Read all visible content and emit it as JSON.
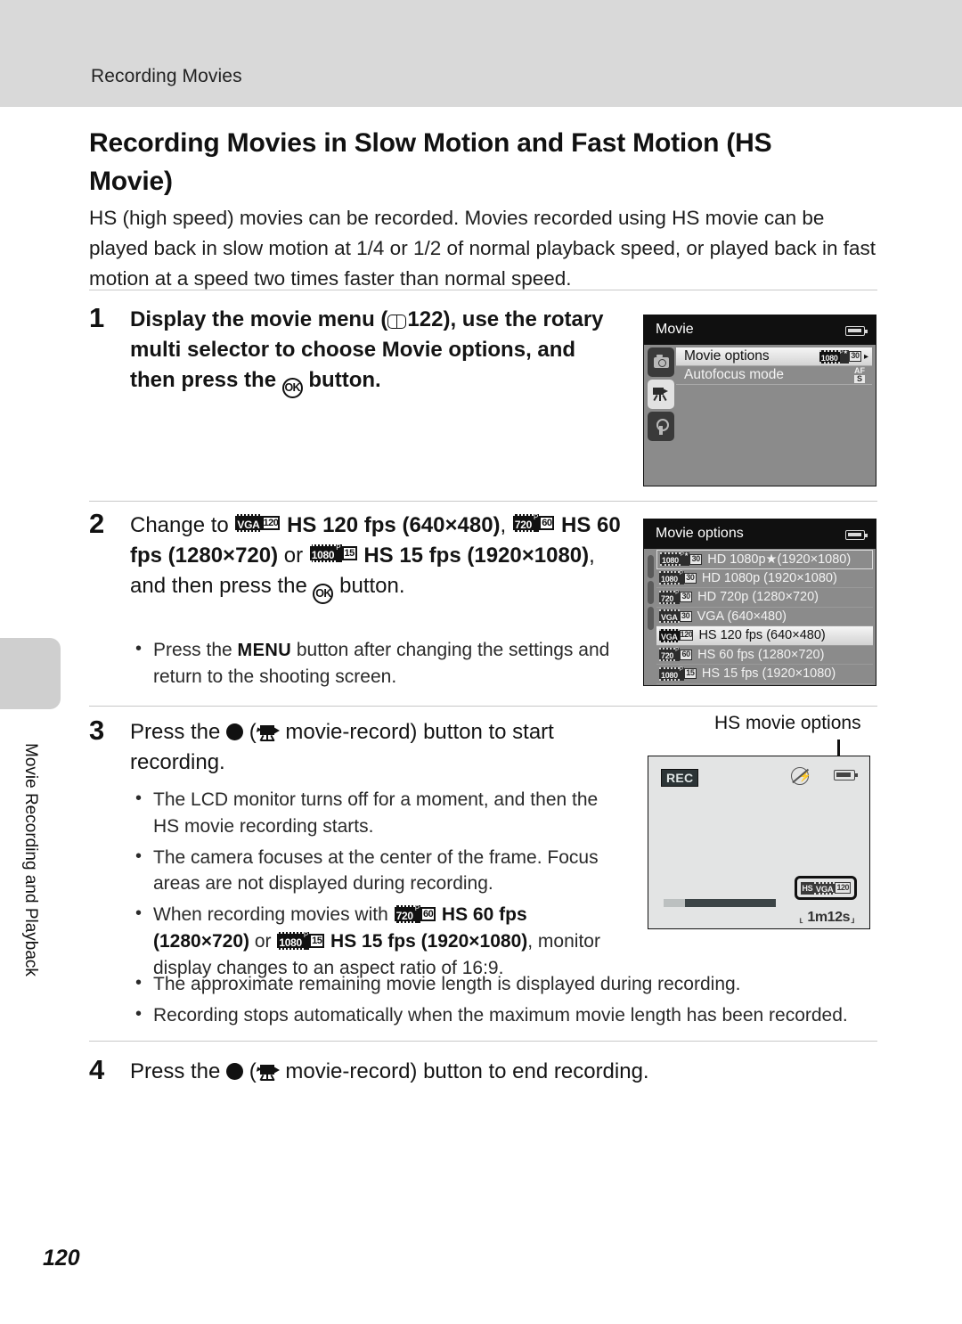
{
  "header": {
    "running_head": "Recording Movies"
  },
  "thumb_tab": {
    "label": "Movie Recording and Playback"
  },
  "title": "Recording Movies in Slow Motion and Fast Motion (HS Movie)",
  "intro": "HS (high speed) movies can be recorded. Movies recorded using HS movie can be played back in slow motion at 1/4 or 1/2 of normal playback speed, or played back in fast motion at a speed two times faster than normal speed.",
  "steps": [
    {
      "number": "1",
      "text_part1": "Display the movie menu (",
      "page_ref": "122",
      "text_part2": "), use the rotary multi selector to choose ",
      "bold1": "Movie options",
      "text_part3": ", and then press the ",
      "ok_label": "OK",
      "text_part4": " button."
    },
    {
      "number": "2",
      "text_part1": "Change to ",
      "bold1": "HS 120 fps (640×480)",
      "text_part2": ", ",
      "bold2": "HS 60 fps (1280×720)",
      "text_part3": " or ",
      "bold3": "HS 15 fps (1920×1080)",
      "text_part4": ", and then press the ",
      "ok_label": "OK",
      "text_part5": " button.",
      "bullets": [
        {
          "part1": "Press the ",
          "menu_label": "MENU",
          "part2": " button after changing the settings and return to the shooting screen."
        }
      ]
    },
    {
      "number": "3",
      "text_part1": "Press the ",
      "text_part2": " (",
      "text_part3": " movie-record) button to start recording.",
      "bullets": [
        {
          "text": "The LCD monitor turns off for a moment, and then the HS movie recording starts."
        },
        {
          "text": "The camera focuses at the center of the frame. Focus areas are not displayed during recording."
        },
        {
          "part1": "When recording movies with ",
          "bold1": "HS 60 fps (1280×720)",
          "part2": " or ",
          "bold2": "HS 15 fps (1920×1080)",
          "part3": ", monitor display changes to an aspect ratio of 16:9."
        },
        {
          "text": "The approximate remaining movie length is displayed during recording."
        },
        {
          "text": "Recording stops automatically when the maximum movie length has been recorded."
        }
      ]
    },
    {
      "number": "4",
      "text_part1": "Press the ",
      "text_part2": " (",
      "text_part3": " movie-record) button to end recording."
    }
  ],
  "figure_movie_menu": {
    "title": "Movie",
    "tabs": [
      {
        "name": "shooting-tab",
        "active": false
      },
      {
        "name": "movie-tab",
        "active": true
      },
      {
        "name": "setup-tab",
        "active": false
      }
    ],
    "rows": [
      {
        "label": "Movie options",
        "selected": true,
        "badge_res": "1080",
        "badge_sup": "P★",
        "badge_fps": "30",
        "arrow": "▸"
      },
      {
        "label": "Autofocus mode",
        "selected": false,
        "af_top": "AF",
        "af_bottom": "S"
      }
    ]
  },
  "figure_movie_options": {
    "title": "Movie options",
    "rows": [
      {
        "label": "HD 1080p★(1920×1080)",
        "res": "1080",
        "sup": "P★",
        "fps": "30",
        "selected": false,
        "boxed": true
      },
      {
        "label": "HD 1080p (1920×1080)",
        "res": "1080",
        "sup": "P",
        "fps": "30",
        "selected": false
      },
      {
        "label": "HD 720p (1280×720)",
        "res": "720",
        "sup": "P",
        "fps": "30",
        "selected": false
      },
      {
        "label": "VGA (640×480)",
        "res": "VGA",
        "sup": "",
        "fps": "30",
        "selected": false
      },
      {
        "label": "HS 120 fps (640×480)",
        "res": "VGA",
        "sup": "",
        "fps": "120",
        "selected": true
      },
      {
        "label": "HS 60 fps (1280×720)",
        "res": "720",
        "sup": "P",
        "fps": "60",
        "selected": false
      },
      {
        "label": "HS 15 fps (1920×1080)",
        "res": "1080",
        "sup": "P",
        "fps": "15",
        "selected": false
      }
    ]
  },
  "figure_shooting": {
    "callout": "HS movie options",
    "rec_label": "REC",
    "hs_badge": {
      "hs": "HS",
      "res": "VGA",
      "fps": "120"
    },
    "remaining_open": "⸤",
    "remaining": "1m12s",
    "remaining_close": "⸥"
  },
  "folio": "120",
  "colors": {
    "header_band": "#d9d9d9",
    "thumb_tab": "#cfcfcf",
    "lcd_bg": "#8b8b8b",
    "lcd_titlebar": "#101010",
    "shoot_bg": "#e3e4e4",
    "rule": "#c8c8c8"
  }
}
